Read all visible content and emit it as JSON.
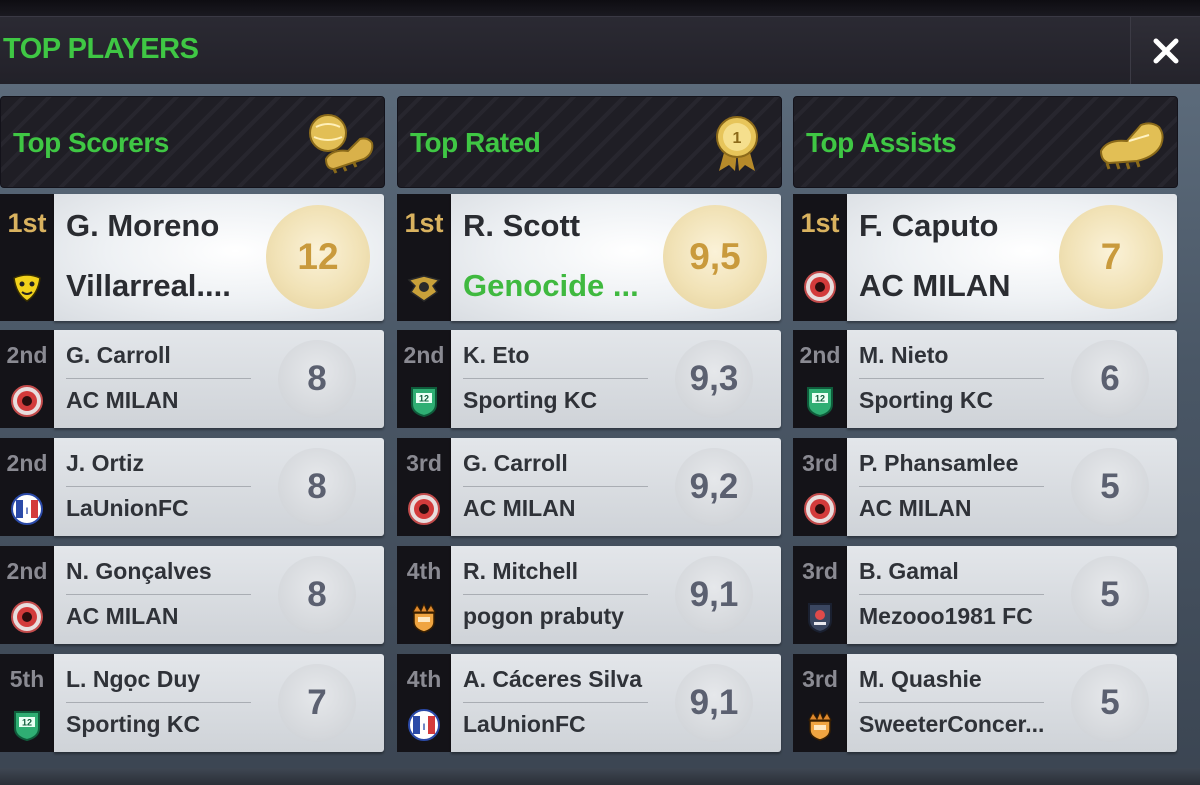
{
  "window": {
    "title": "TOP PLAYERS"
  },
  "columns": [
    {
      "heading": "Top Scorers",
      "trophy_icon": "golden-ball-boot-trophy-icon",
      "rows": [
        {
          "rank": "1st",
          "player": "G. Moreno",
          "club": "Villarreal....",
          "club_icon": "villarreal-yellow-crest-icon",
          "value": "12"
        },
        {
          "rank": "2nd",
          "player": "G. Carroll",
          "club": "AC MILAN",
          "club_icon": "ac-milan-red-crest-icon",
          "value": "8"
        },
        {
          "rank": "2nd",
          "player": "J. Ortiz",
          "club": "LaUnionFC",
          "club_icon": "launionfc-ita-crest-icon",
          "value": "8"
        },
        {
          "rank": "2nd",
          "player": "N. Gonçalves",
          "club": "AC MILAN",
          "club_icon": "ac-milan-red-crest-icon",
          "value": "8"
        },
        {
          "rank": "5th",
          "player": "L. Ngọc Duy",
          "club": "Sporting KC",
          "club_icon": "sporting-kc-green-crest-icon",
          "value": "7"
        }
      ]
    },
    {
      "heading": "Top Rated",
      "trophy_icon": "gold-medal-icon",
      "rows": [
        {
          "rank": "1st",
          "player": "R. Scott",
          "club": "Genocide ...",
          "club_highlight": true,
          "club_icon": "genocide-eagle-crest-icon",
          "value": "9,5"
        },
        {
          "rank": "2nd",
          "player": "K. Eto",
          "club": "Sporting KC",
          "club_icon": "sporting-kc-green-crest-icon",
          "value": "9,3"
        },
        {
          "rank": "3rd",
          "player": "G. Carroll",
          "club": "AC MILAN",
          "club_icon": "ac-milan-red-crest-icon",
          "value": "9,2"
        },
        {
          "rank": "4th",
          "player": "R. Mitchell",
          "club": "pogon prabuty",
          "club_icon": "pogon-prabuty-crown-crest-icon",
          "value": "9,1"
        },
        {
          "rank": "4th",
          "player": "A. Cáceres Silva",
          "club": "LaUnionFC",
          "club_icon": "launionfc-ita-crest-icon",
          "value": "9,1"
        }
      ]
    },
    {
      "heading": "Top Assists",
      "trophy_icon": "golden-boot-icon",
      "rows": [
        {
          "rank": "1st",
          "player": "F. Caputo",
          "club": "AC MILAN",
          "club_icon": "ac-milan-red-crest-icon",
          "value": "7"
        },
        {
          "rank": "2nd",
          "player": "M. Nieto",
          "club": "Sporting KC",
          "club_icon": "sporting-kc-green-crest-icon",
          "value": "6"
        },
        {
          "rank": "3rd",
          "player": "P. Phansamlee",
          "club": "AC MILAN",
          "club_icon": "ac-milan-red-crest-icon",
          "value": "5"
        },
        {
          "rank": "3rd",
          "player": "B. Gamal",
          "club": "Mezooo1981 FC",
          "club_icon": "mezooo1981-shield-crest-icon",
          "value": "5"
        },
        {
          "rank": "3rd",
          "player": "M. Quashie",
          "club": "SweeterConcer...",
          "club_icon": "sweeterconcer-crown-crest-icon",
          "value": "5"
        }
      ]
    }
  ],
  "colors": {
    "accent_green": "#3fc744",
    "gold_rank": "#d9b25f",
    "card_text": "#2f3238",
    "value_text": "#5b6070"
  }
}
